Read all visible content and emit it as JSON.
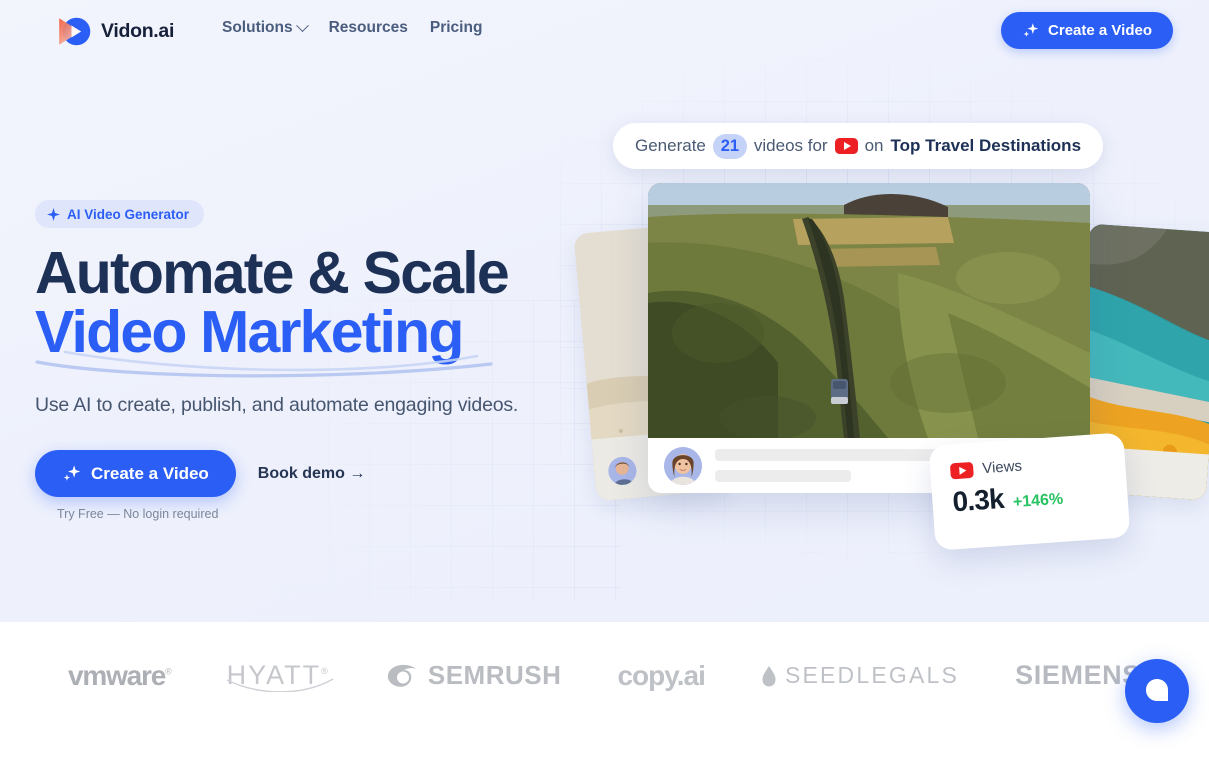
{
  "brand": {
    "name": "Vidon.ai",
    "logo_icon": "vidon-play-logo",
    "primary_color": "#2b5ef4",
    "accent_color": "#ef4f35"
  },
  "nav": {
    "items": [
      {
        "label": "Solutions",
        "has_dropdown": true,
        "icon": "chevron-down-icon"
      },
      {
        "label": "Resources",
        "has_dropdown": false
      },
      {
        "label": "Pricing",
        "has_dropdown": false
      }
    ],
    "cta": {
      "label": "Create a Video",
      "icon": "sparkle-icon"
    }
  },
  "hero": {
    "badge": {
      "label": "AI Video Generator",
      "icon": "sparkle-icon"
    },
    "headline_line1": "Automate & Scale",
    "headline_line2": "Video Marketing",
    "subtitle": "Use AI to create, publish, and automate engaging videos.",
    "primary_cta": {
      "label": "Create a Video",
      "icon": "sparkle-icon"
    },
    "secondary_cta": {
      "label": "Book demo →"
    },
    "trial_note": "Try Free — No login required"
  },
  "visual": {
    "prompt_pill": {
      "prefix": "Generate",
      "count": "21",
      "middle": "videos for",
      "platform_icon": "youtube-icon",
      "connector": "on",
      "topic": "Top Travel Destinations"
    },
    "stat_card": {
      "platform_icon": "youtube-icon",
      "label": "Views",
      "value": "0.3k",
      "delta": "+146%",
      "delta_color": "#27c261"
    },
    "main_card": {
      "media_alt": "aerial-road-landscape",
      "avatar": "avatar-woman"
    },
    "side_card_left": {
      "media_alt": "desert-beach-scene",
      "avatar": "avatar-man"
    },
    "side_card_right": {
      "media_alt": "coastal-cliff-scene"
    }
  },
  "logos": [
    {
      "name": "vmware",
      "text": "vmware"
    },
    {
      "name": "hyatt",
      "text": "HYATT"
    },
    {
      "name": "semrush",
      "text": "SEMRUSH"
    },
    {
      "name": "copy.ai",
      "text": "copy.ai"
    },
    {
      "name": "seedlegals",
      "text": "SEEDLEGALS"
    },
    {
      "name": "siemens",
      "text": "SIEMENS"
    }
  ],
  "chat_widget": {
    "icon": "chat-bubble-icon",
    "color": "#2b5ef4"
  }
}
